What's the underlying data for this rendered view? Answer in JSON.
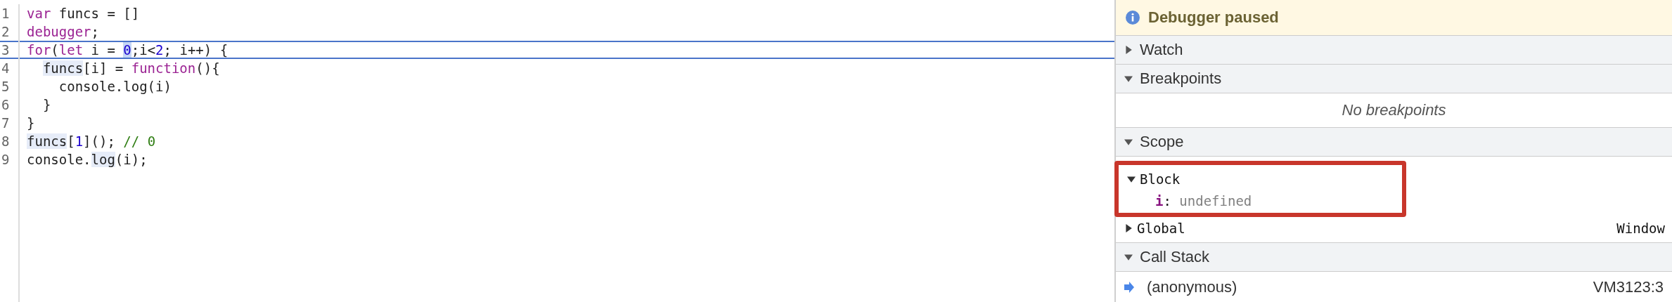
{
  "editor": {
    "lines": [
      {
        "number": "1",
        "current": false,
        "tokens": [
          {
            "text": "var",
            "kind": "keyword",
            "highlighted": false
          },
          {
            "text": " funcs = []",
            "kind": "plain",
            "highlighted": false
          }
        ]
      },
      {
        "number": "2",
        "current": false,
        "tokens": [
          {
            "text": "debugger",
            "kind": "keyword",
            "highlighted": false
          },
          {
            "text": ";",
            "kind": "plain",
            "highlighted": false
          }
        ]
      },
      {
        "number": "3",
        "current": true,
        "tokens": [
          {
            "text": "for",
            "kind": "keyword",
            "highlighted": false
          },
          {
            "text": "(",
            "kind": "plain",
            "highlighted": false
          },
          {
            "text": "let",
            "kind": "keyword",
            "highlighted": false
          },
          {
            "text": " i = ",
            "kind": "plain",
            "highlighted": false
          },
          {
            "text": "0",
            "kind": "number",
            "highlighted": true
          },
          {
            "text": ";i<",
            "kind": "plain",
            "highlighted": false
          },
          {
            "text": "2",
            "kind": "number",
            "highlighted": false
          },
          {
            "text": "; i++) {",
            "kind": "plain",
            "highlighted": false
          }
        ]
      },
      {
        "number": "4",
        "current": false,
        "tokens": [
          {
            "text": "  funcs",
            "kind": "plain",
            "highlighted": true
          },
          {
            "text": "[i] = ",
            "kind": "plain",
            "highlighted": false
          },
          {
            "text": "function",
            "kind": "keyword",
            "highlighted": false
          },
          {
            "text": "(){",
            "kind": "plain",
            "highlighted": false
          }
        ]
      },
      {
        "number": "5",
        "current": false,
        "tokens": [
          {
            "text": "    console.log(i)",
            "kind": "plain",
            "highlighted": false
          }
        ]
      },
      {
        "number": "6",
        "current": false,
        "tokens": [
          {
            "text": "  }",
            "kind": "plain",
            "highlighted": false
          }
        ]
      },
      {
        "number": "7",
        "current": false,
        "tokens": [
          {
            "text": "}",
            "kind": "plain",
            "highlighted": false
          }
        ]
      },
      {
        "number": "8",
        "current": false,
        "tokens": [
          {
            "text": "funcs",
            "kind": "plain",
            "highlighted": true
          },
          {
            "text": "[",
            "kind": "plain",
            "highlighted": false
          },
          {
            "text": "1",
            "kind": "number",
            "highlighted": false
          },
          {
            "text": "](); ",
            "kind": "plain",
            "highlighted": false
          },
          {
            "text": "// 0",
            "kind": "comment",
            "highlighted": false
          }
        ]
      },
      {
        "number": "9",
        "current": false,
        "tokens": [
          {
            "text": "console.",
            "kind": "plain",
            "highlighted": false
          },
          {
            "text": "log",
            "kind": "plain",
            "highlighted": true
          },
          {
            "text": "(i);",
            "kind": "plain",
            "highlighted": false
          }
        ]
      }
    ]
  },
  "debugger": {
    "banner": "Debugger paused",
    "sections": [
      {
        "title": "Watch",
        "expanded": false
      },
      {
        "title": "Breakpoints",
        "expanded": true,
        "empty_text": "No breakpoints"
      },
      {
        "title": "Scope",
        "expanded": true,
        "scopes": [
          {
            "name": "Block",
            "expanded": true,
            "framed": true,
            "variables": [
              {
                "name": "i",
                "separator": ":",
                "value": "undefined"
              }
            ]
          },
          {
            "name": "Global",
            "expanded": false,
            "framed": false,
            "value": "Window"
          }
        ]
      },
      {
        "title": "Call Stack",
        "expanded": true,
        "frames": [
          {
            "name": "(anonymous)",
            "location": "VM3123:3",
            "current": true
          }
        ]
      }
    ]
  }
}
